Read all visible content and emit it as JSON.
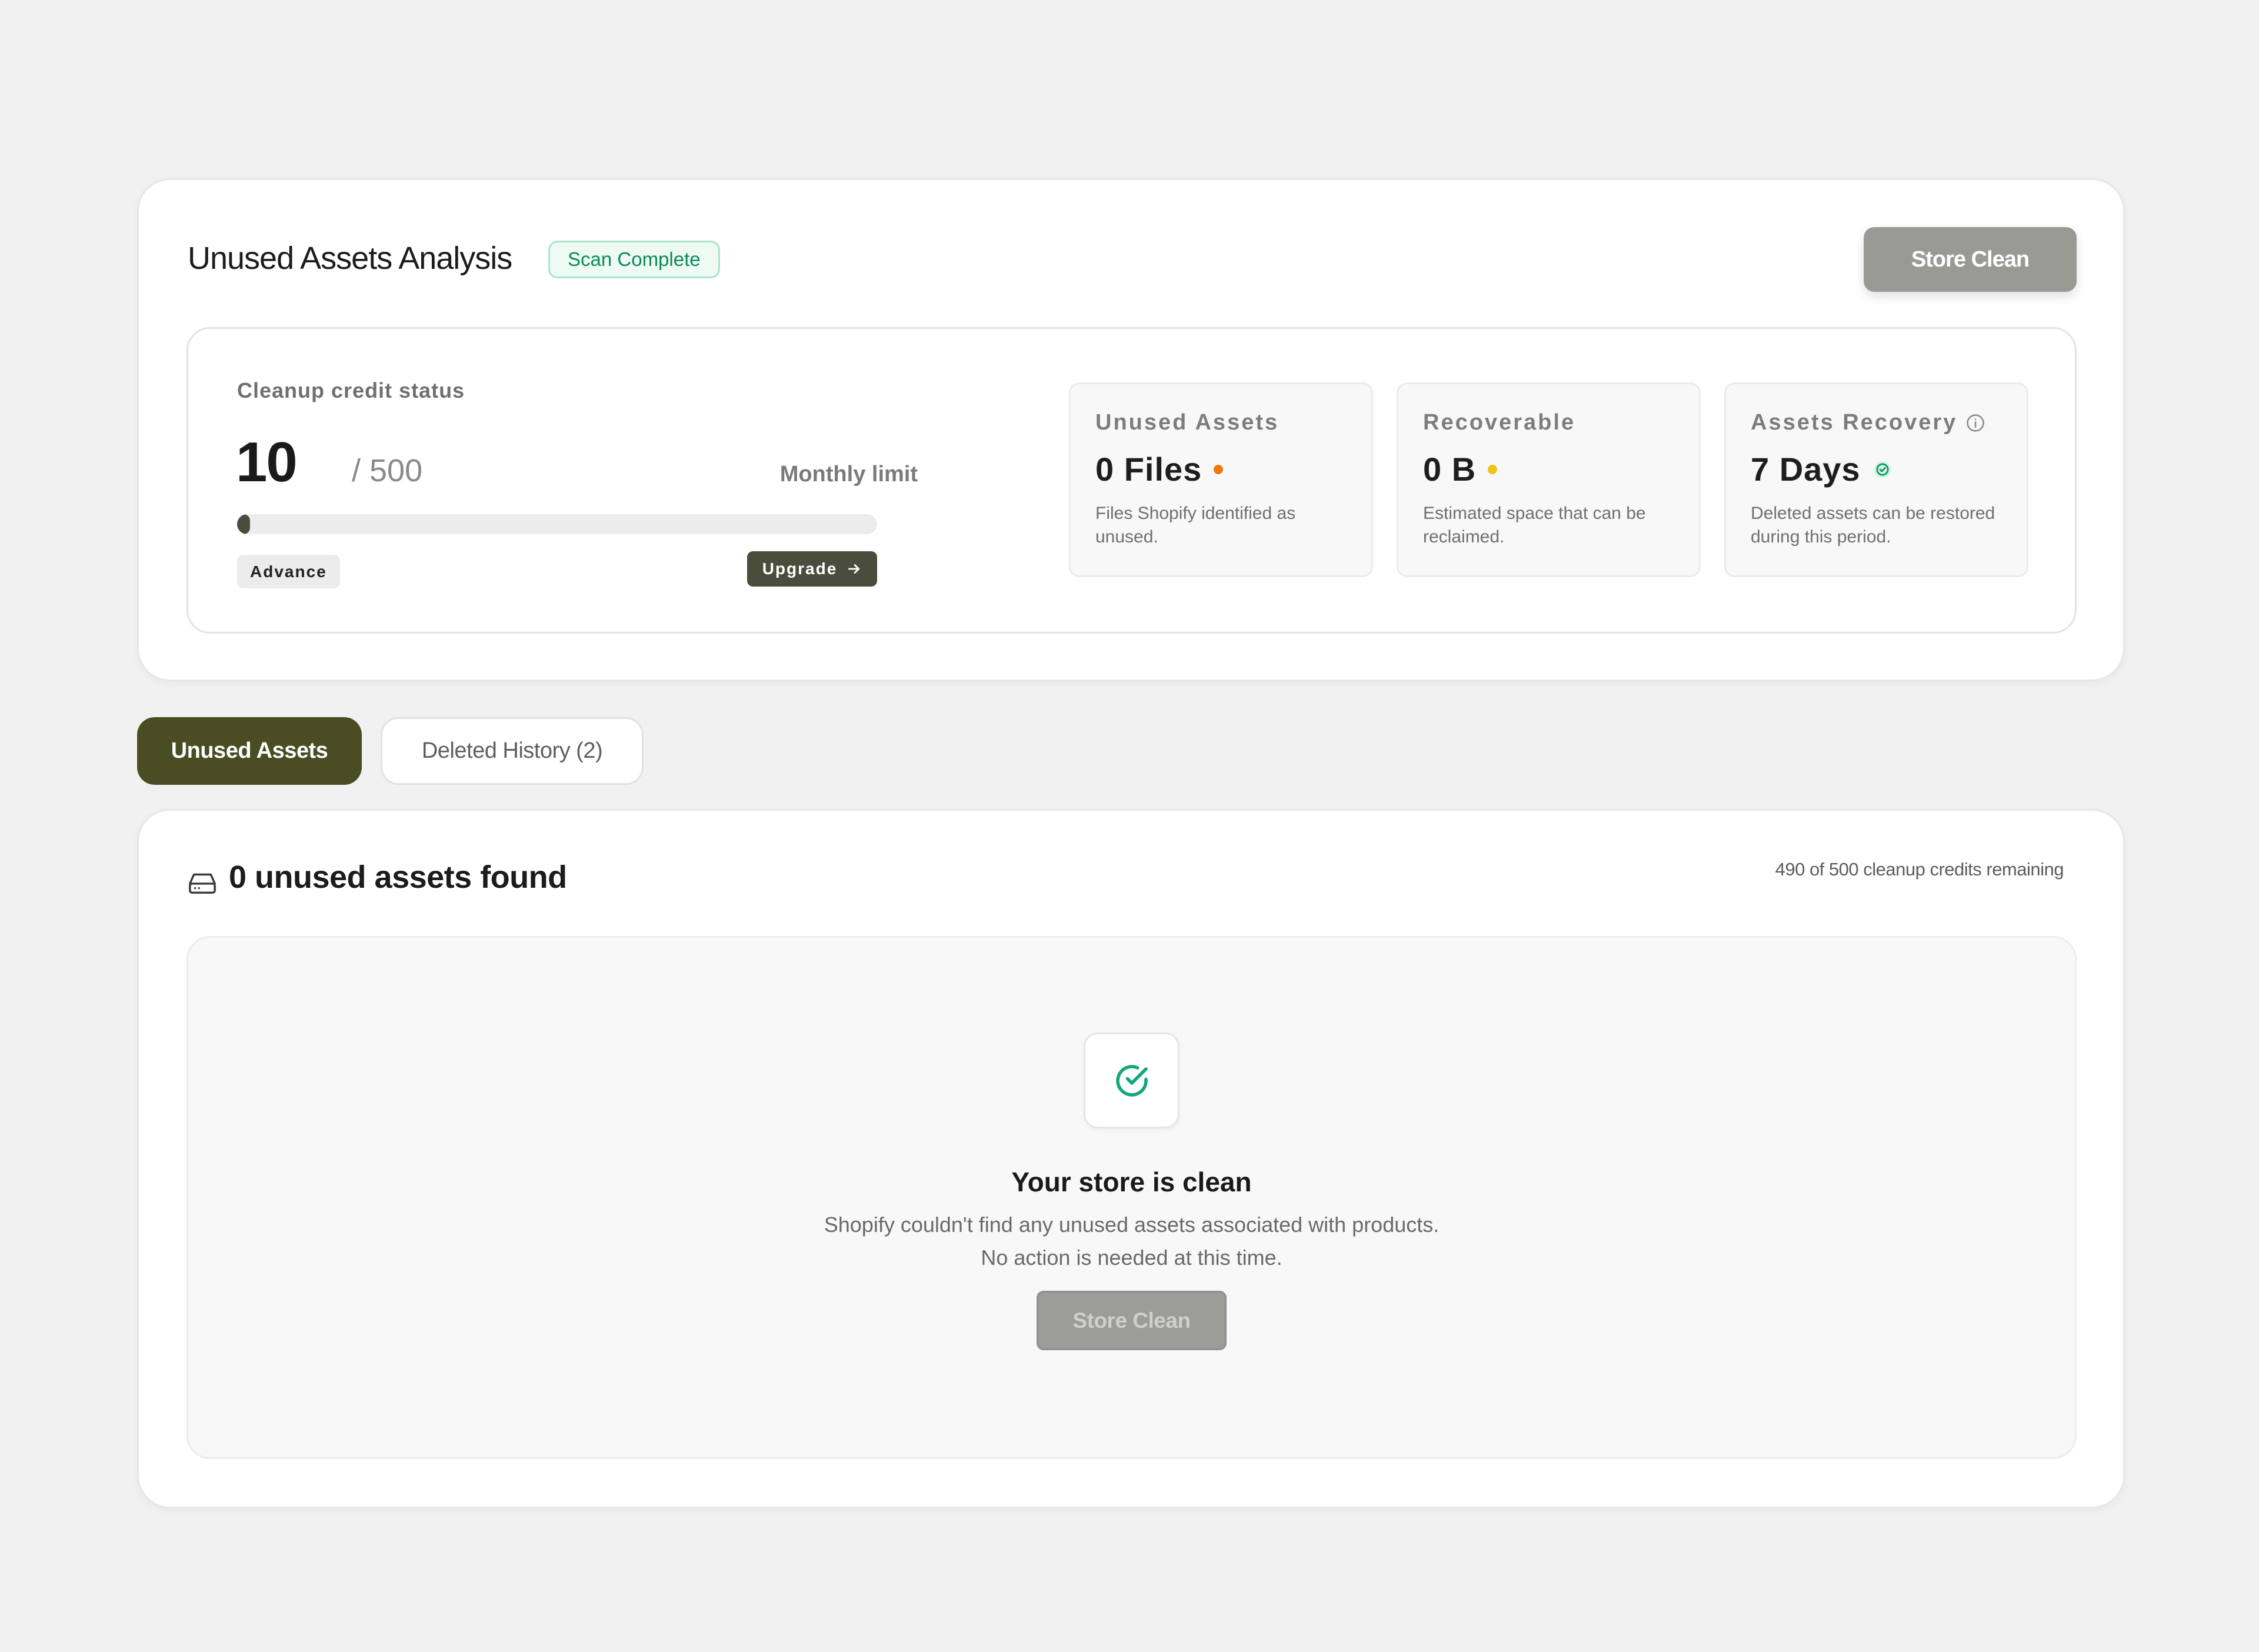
{
  "header": {
    "title": "Unused Assets Analysis",
    "badge": "Scan Complete",
    "action_label": "Store Clean"
  },
  "credit": {
    "label": "Cleanup credit status",
    "used": "10",
    "total": "/ 500",
    "limit_label": "Monthly limit",
    "progress_fraction": 0.02,
    "plan": "Advance",
    "upgrade_label": "Upgrade",
    "upgrade_icon": "arrow-right-icon"
  },
  "stats": [
    {
      "title": "Unused Assets",
      "value": "0 Files",
      "indicator_color": "#f2780c",
      "description": "Files Shopify identified as unused."
    },
    {
      "title": "Recoverable",
      "value": "0 B",
      "indicator_color": "#f2c21b",
      "description": "Estimated space that can be reclaimed."
    },
    {
      "title": "Assets Recovery",
      "title_icon": "info-icon",
      "value": "7 Days",
      "value_icon": "check-circle-icon",
      "description": "Deleted assets can be restored during this period."
    }
  ],
  "tabs": [
    {
      "label": "Unused Assets",
      "active": true
    },
    {
      "label": "Deleted History (2)",
      "active": false
    }
  ],
  "list": {
    "icon": "hard-drive-icon",
    "title": "0 unused assets found",
    "credits_remaining": "490 of 500 cleanup credits remaining"
  },
  "empty_state": {
    "icon": "check-circle-icon",
    "title": "Your store is clean",
    "line1": "Shopify couldn't find any unused assets associated with products.",
    "line2": "No action is needed at this time.",
    "button_label": "Store Clean"
  },
  "colors": {
    "accent_dark": "#4a4d24",
    "success": "#0a9a64",
    "disabled_button": "#9a9a95"
  }
}
